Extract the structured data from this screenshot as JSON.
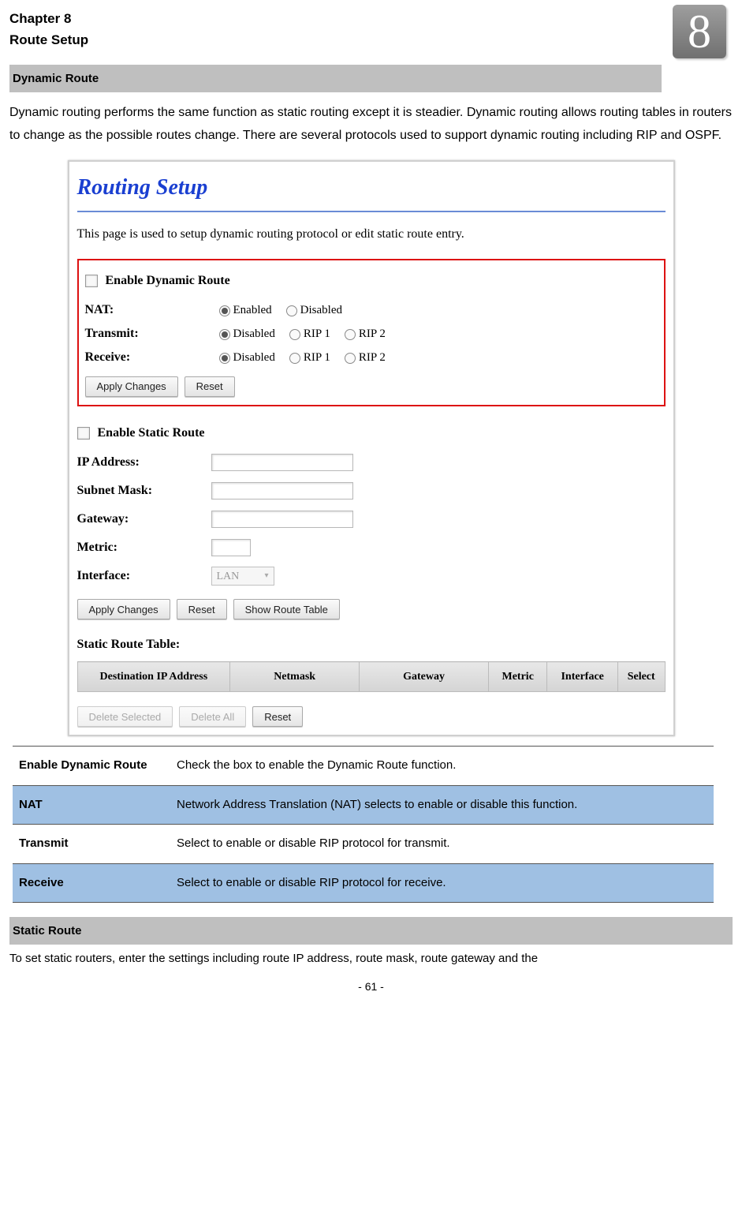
{
  "chapter": {
    "line1": "Chapter 8",
    "line2": "Route Setup",
    "number": "8"
  },
  "section1": {
    "title": "Dynamic Route",
    "paragraph": "Dynamic routing performs the same function as static routing except it is steadier. Dynamic routing allows routing tables in routers to change as the possible routes change. There are several protocols used to support dynamic routing including RIP and OSPF."
  },
  "screenshot": {
    "title": "Routing Setup",
    "desc": "This page is used to setup dynamic routing protocol or edit static route entry.",
    "dyn": {
      "enable_label": "Enable Dynamic Route",
      "nat_label": "NAT:",
      "nat_opts": [
        "Enabled",
        "Disabled"
      ],
      "transmit_label": "Transmit:",
      "receive_label": "Receive:",
      "rip_opts": [
        "Disabled",
        "RIP 1",
        "RIP 2"
      ],
      "apply": "Apply Changes",
      "reset": "Reset"
    },
    "static": {
      "enable_label": "Enable Static Route",
      "ip_label": "IP Address:",
      "subnet_label": "Subnet Mask:",
      "gateway_label": "Gateway:",
      "metric_label": "Metric:",
      "interface_label": "Interface:",
      "interface_value": "LAN",
      "apply": "Apply Changes",
      "reset": "Reset",
      "show": "Show Route Table"
    },
    "table": {
      "title": "Static Route Table:",
      "headers": [
        "Destination IP Address",
        "Netmask",
        "Gateway",
        "Metric",
        "Interface",
        "Select"
      ],
      "delete_selected": "Delete Selected",
      "delete_all": "Delete All",
      "reset": "Reset"
    }
  },
  "desc_rows": [
    {
      "k": "Enable Dynamic Route",
      "v": "Check the box to enable the Dynamic Route function."
    },
    {
      "k": "NAT",
      "v": "Network Address Translation (NAT) selects to enable or disable this function."
    },
    {
      "k": "Transmit",
      "v": "Select to enable or disable RIP protocol for transmit."
    },
    {
      "k": "Receive",
      "v": "Select to enable or disable RIP protocol for receive."
    }
  ],
  "section2": {
    "title": "Static Route",
    "paragraph": "To set static routers, enter the settings including route IP address, route mask, route gateway and the"
  },
  "footer": "- 61 -"
}
